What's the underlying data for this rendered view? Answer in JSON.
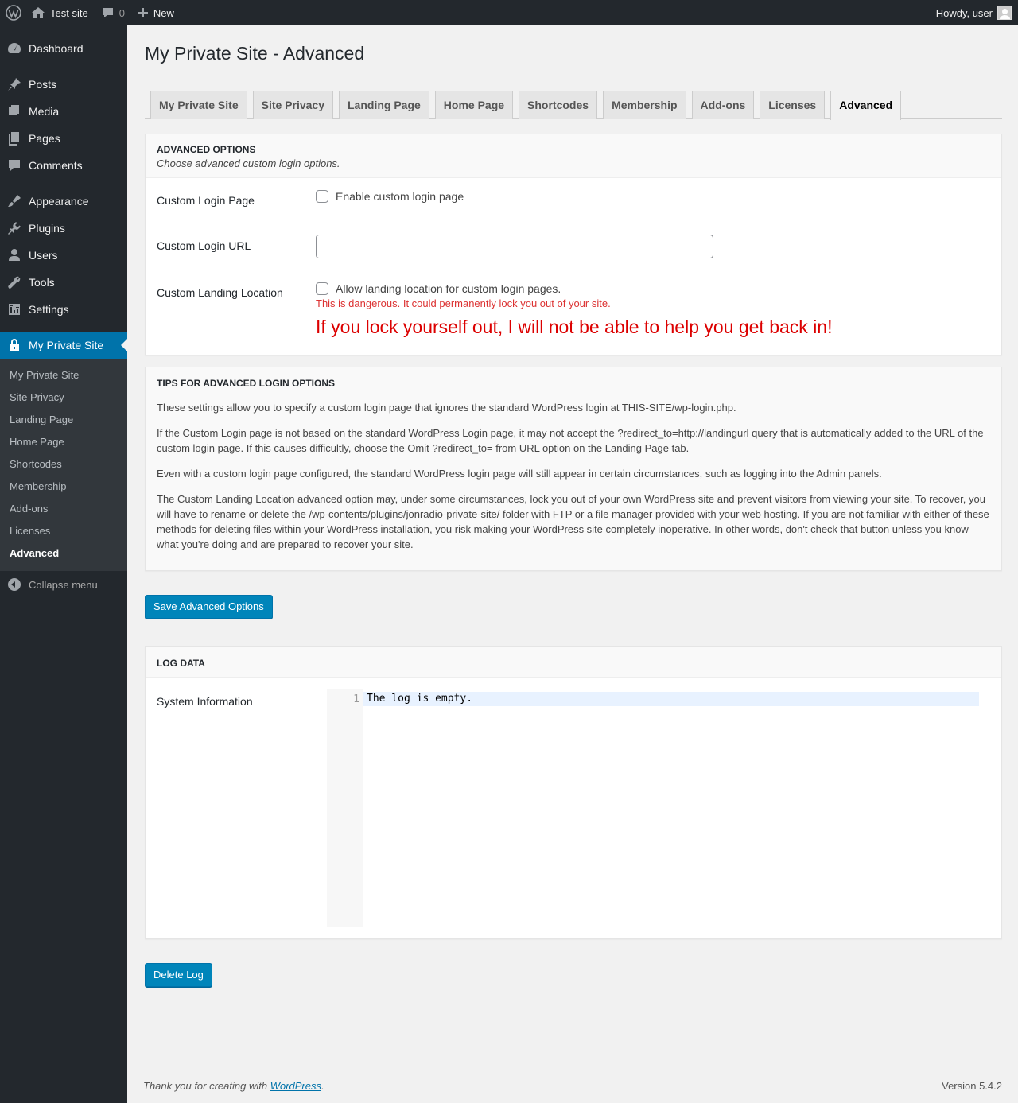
{
  "admin_bar": {
    "site_name": "Test site",
    "comments_count": "0",
    "new_label": "New",
    "howdy": "Howdy, user"
  },
  "sidebar": {
    "menu": [
      {
        "label": "Dashboard",
        "icon": "dashboard-icon"
      },
      {
        "label": "Posts",
        "icon": "pin-icon"
      },
      {
        "label": "Media",
        "icon": "media-icon"
      },
      {
        "label": "Pages",
        "icon": "pages-icon"
      },
      {
        "label": "Comments",
        "icon": "comment-icon"
      },
      {
        "label": "Appearance",
        "icon": "brush-icon"
      },
      {
        "label": "Plugins",
        "icon": "plugin-icon"
      },
      {
        "label": "Users",
        "icon": "user-icon"
      },
      {
        "label": "Tools",
        "icon": "wrench-icon"
      },
      {
        "label": "Settings",
        "icon": "settings-icon"
      },
      {
        "label": "My Private Site",
        "icon": "lock-icon"
      }
    ],
    "submenu": [
      "My Private Site",
      "Site Privacy",
      "Landing Page",
      "Home Page",
      "Shortcodes",
      "Membership",
      "Add-ons",
      "Licenses",
      "Advanced"
    ],
    "collapse_label": "Collapse menu"
  },
  "page": {
    "title": "My Private Site - Advanced",
    "tabs": [
      "My Private Site",
      "Site Privacy",
      "Landing Page",
      "Home Page",
      "Shortcodes",
      "Membership",
      "Add-ons",
      "Licenses",
      "Advanced"
    ],
    "active_tab": "Advanced"
  },
  "advanced_options": {
    "heading": "ADVANCED OPTIONS",
    "subheading": "Choose advanced custom login options.",
    "custom_login_page_label": "Custom Login Page",
    "custom_login_page_checkbox": "Enable custom login page",
    "custom_login_url_label": "Custom Login URL",
    "custom_login_url_value": "",
    "custom_landing_label": "Custom Landing Location",
    "custom_landing_checkbox": "Allow landing location for custom login pages.",
    "danger_text": "This is dangerous. It could permanently lock you out of your site.",
    "big_warning": "If you lock yourself out, I will not be able to help you get back in!"
  },
  "tips": {
    "heading": "TIPS FOR ADVANCED LOGIN OPTIONS",
    "paragraphs": [
      "These settings allow you to specify a custom login page that ignores the standard WordPress login at THIS-SITE/wp-login.php.",
      "If the Custom Login page is not based on the standard WordPress Login page, it may not accept the ?redirect_to=http://landingurl query that is automatically added to the URL of the custom login page. If this causes difficultly, choose the Omit ?redirect_to= from URL option on the Landing Page tab.",
      "Even with a custom login page configured, the standard WordPress login page will still appear in certain circumstances, such as logging into the Admin panels.",
      "The Custom Landing Location advanced option may, under some circumstances, lock you out of your own WordPress site and prevent visitors from viewing your site. To recover, you will have to rename or delete the /wp-contents/plugins/jonradio-private-site/ folder with FTP or a file manager provided with your web hosting. If you are not familiar with either of these methods for deleting files within your WordPress installation, you risk making your WordPress site completely inoperative. In other words, don't check that button unless you know what you're doing and are prepared to recover your site."
    ]
  },
  "save_button": "Save Advanced Options",
  "log": {
    "heading": "LOG DATA",
    "label": "System Information",
    "line_number": "1",
    "line_text": "The log is empty."
  },
  "delete_button": "Delete Log",
  "footer": {
    "thanks_prefix": "Thank you for creating with ",
    "wordpress_link": "WordPress",
    "thanks_suffix": ".",
    "version": "Version 5.4.2"
  },
  "colors": {
    "admin_bar": "#23282d",
    "accent": "#0073aa",
    "danger": "#dc3232"
  }
}
